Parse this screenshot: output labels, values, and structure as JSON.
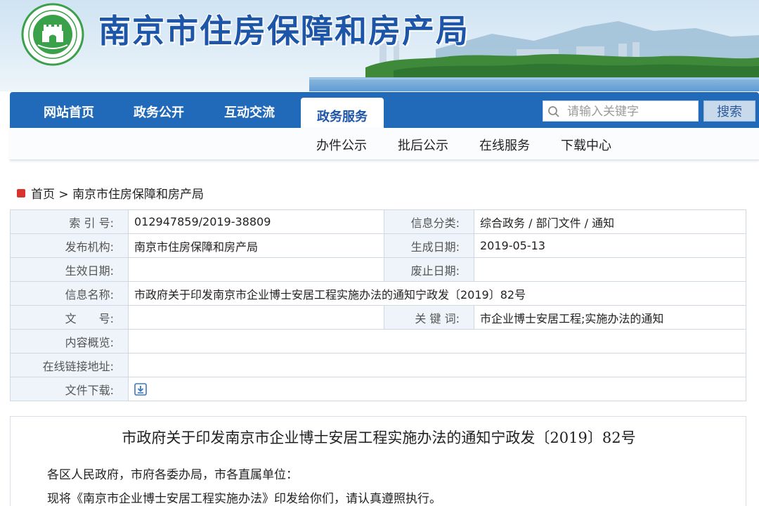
{
  "site": {
    "title": "南京市住房保障和房产局"
  },
  "nav": {
    "items": [
      {
        "label": "网站首页"
      },
      {
        "label": "政务公开"
      },
      {
        "label": "互动交流"
      },
      {
        "label": "政务服务"
      }
    ],
    "active_index": 3,
    "search_placeholder": "请输入关键字",
    "search_button": "搜索"
  },
  "subnav": {
    "items": [
      {
        "label": "办件公示"
      },
      {
        "label": "批后公示"
      },
      {
        "label": "在线服务"
      },
      {
        "label": "下载中心"
      }
    ]
  },
  "breadcrumb": {
    "home": "首页",
    "separator": ">",
    "current": "南京市住房保障和房产局"
  },
  "info": {
    "index_label": "索 引 号:",
    "index_value": "012947859/2019-38809",
    "category_label": "信息分类:",
    "category_value": "综合政务 / 部门文件 / 通知",
    "publisher_label": "发布机构:",
    "publisher_value": "南京市住房保障和房产局",
    "created_label": "生成日期:",
    "created_value": "2019-05-13",
    "effective_label": "生效日期:",
    "effective_value": "",
    "expire_label": "废止日期:",
    "expire_value": "",
    "name_label": "信息名称:",
    "name_value": "市政府关于印发南京市企业博士安居工程实施办法的通知宁政发〔2019〕82号",
    "docno_label": "文　　号:",
    "docno_value": "",
    "keywords_label": "关 键 词:",
    "keywords_value": "市企业博士安居工程;实施办法的通知",
    "summary_label": "内容概览:",
    "summary_value": "",
    "link_label": "在线链接地址:",
    "link_value": "",
    "download_label": "文件下载:"
  },
  "article": {
    "title": "市政府关于印发南京市企业博士安居工程实施办法的通知宁政发〔2019〕82号",
    "para1": "各区人民政府，市府各委办局，市各直属单位：",
    "para2": "现将《南京市企业博士安居工程实施办法》印发给你们，请认真遵照执行。"
  },
  "colors": {
    "nav_blue": "#2169b9",
    "title_blue": "#1d56a8",
    "label_bg": "#eef4fa",
    "breadcrumb_icon": "#d9342b",
    "logo_green": "#3aa04a"
  }
}
